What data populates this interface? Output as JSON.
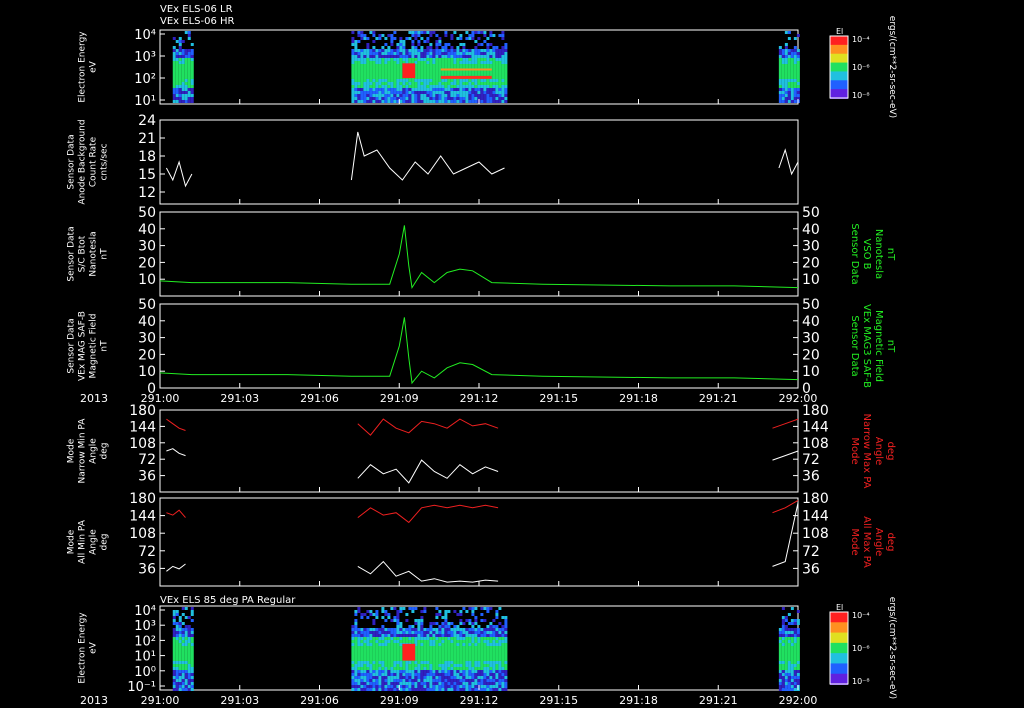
{
  "header": {
    "line1": "VEx ELS-06 LR",
    "line2": "VEx ELS-06 HR"
  },
  "bottom_title": "VEx ELS 85 deg PA Regular",
  "year": "2013",
  "x_ticks": [
    "291:00",
    "291:03",
    "291:06",
    "291:09",
    "291:12",
    "291:15",
    "291:18",
    "291:21",
    "292:00"
  ],
  "colorbar": {
    "title": "El",
    "ticks": [
      "10⁻⁴",
      "10⁻⁶",
      "10⁻⁸"
    ],
    "unit": "ergs/(cm**2-sr-sec-eV)"
  },
  "colors": {
    "bg": "#000000",
    "frame": "#ffffff",
    "green": "#22ee22",
    "red": "#ee2020",
    "white": "#ffffff"
  },
  "chart_data": [
    {
      "type": "heatmap",
      "panel": "spectrogram-top",
      "ylabel": [
        "Electron Energy",
        "eV"
      ],
      "yticks": [
        "10⁴",
        "10³",
        "10²",
        "10¹"
      ],
      "data_intervals": [
        [
          0.02,
          0.05
        ],
        [
          0.3,
          0.54
        ],
        [
          0.97,
          1.0
        ]
      ],
      "hot_spots": [
        [
          0.38,
          0.4,
          "peak"
        ],
        [
          0.44,
          0.52,
          "band"
        ]
      ]
    },
    {
      "type": "line",
      "panel": "background",
      "ylabel": [
        "Sensor Data",
        "Anode Background",
        "Count Rate",
        "cnts/sec"
      ],
      "ylim": [
        10,
        24
      ],
      "yticks": [
        24,
        21,
        18,
        15,
        12
      ],
      "series": [
        {
          "segments": [
            [
              [
                0.01,
                16
              ],
              [
                0.02,
                14
              ],
              [
                0.03,
                17
              ],
              [
                0.04,
                13
              ],
              [
                0.05,
                15
              ]
            ],
            [
              [
                0.3,
                14
              ],
              [
                0.31,
                22
              ],
              [
                0.32,
                18
              ],
              [
                0.34,
                19
              ],
              [
                0.36,
                16
              ],
              [
                0.38,
                14
              ],
              [
                0.4,
                17
              ],
              [
                0.42,
                15
              ],
              [
                0.44,
                18
              ],
              [
                0.46,
                15
              ],
              [
                0.48,
                16
              ],
              [
                0.5,
                17
              ],
              [
                0.52,
                15
              ],
              [
                0.54,
                16
              ]
            ],
            [
              [
                0.97,
                16
              ],
              [
                0.98,
                19
              ],
              [
                0.99,
                15
              ],
              [
                1.0,
                17
              ]
            ]
          ]
        }
      ]
    },
    {
      "type": "line",
      "panel": "mag-vso",
      "ylabel": [
        "Sensor Data",
        "S/C Btot",
        "Nanotesla",
        "nT"
      ],
      "ylabel_right": [
        "Sensor Data",
        "VSO B",
        "Nanotesla",
        "nT"
      ],
      "ylim": [
        0,
        50
      ],
      "yticks": [
        50,
        40,
        30,
        20,
        10
      ],
      "series": [
        {
          "segments": [
            [
              [
                0.0,
                9
              ],
              [
                0.05,
                8
              ],
              [
                0.2,
                8
              ],
              [
                0.3,
                7
              ],
              [
                0.36,
                7
              ],
              [
                0.375,
                25
              ],
              [
                0.383,
                42
              ],
              [
                0.39,
                18
              ],
              [
                0.395,
                5
              ],
              [
                0.41,
                14
              ],
              [
                0.43,
                8
              ],
              [
                0.45,
                14
              ],
              [
                0.47,
                16
              ],
              [
                0.49,
                15
              ],
              [
                0.52,
                8
              ],
              [
                0.6,
                7
              ],
              [
                0.8,
                6
              ],
              [
                0.9,
                6
              ],
              [
                1.0,
                5
              ]
            ]
          ]
        }
      ]
    },
    {
      "type": "line",
      "panel": "mag-saf",
      "ylabel": [
        "Sensor Data",
        "VEx MAG SAF-B",
        "Magnetic Field",
        "nT"
      ],
      "ylabel_right": [
        "Sensor Data",
        "VEx MAG3 SAF-B",
        "Magnetic Field",
        "nT"
      ],
      "ylim": [
        0,
        50
      ],
      "yticks": [
        50,
        40,
        30,
        20,
        10,
        0
      ],
      "series": [
        {
          "segments": [
            [
              [
                0.0,
                9
              ],
              [
                0.05,
                8
              ],
              [
                0.2,
                8
              ],
              [
                0.3,
                7
              ],
              [
                0.36,
                7
              ],
              [
                0.375,
                25
              ],
              [
                0.383,
                42
              ],
              [
                0.39,
                18
              ],
              [
                0.395,
                3
              ],
              [
                0.41,
                10
              ],
              [
                0.43,
                6
              ],
              [
                0.45,
                12
              ],
              [
                0.47,
                15
              ],
              [
                0.49,
                14
              ],
              [
                0.52,
                8
              ],
              [
                0.6,
                7
              ],
              [
                0.8,
                6
              ],
              [
                0.9,
                6
              ],
              [
                1.0,
                5
              ]
            ]
          ]
        }
      ]
    },
    {
      "type": "line",
      "panel": "pa-narrow",
      "ylabel": [
        "Mode",
        "Narrow Min PA",
        "Angle",
        "deg"
      ],
      "ylabel_right": [
        "Mode",
        "Narrow Max PA",
        "Angle",
        "deg"
      ],
      "ylim": [
        0,
        180
      ],
      "yticks": [
        180,
        144,
        108,
        72,
        36
      ],
      "series": [
        {
          "color": "red",
          "segments": [
            [
              [
                0.01,
                160
              ],
              [
                0.02,
                150
              ],
              [
                0.03,
                140
              ],
              [
                0.04,
                135
              ]
            ],
            [
              [
                0.31,
                150
              ],
              [
                0.33,
                125
              ],
              [
                0.35,
                160
              ],
              [
                0.37,
                140
              ],
              [
                0.39,
                130
              ],
              [
                0.41,
                155
              ],
              [
                0.43,
                150
              ],
              [
                0.45,
                140
              ],
              [
                0.47,
                160
              ],
              [
                0.49,
                145
              ],
              [
                0.51,
                150
              ],
              [
                0.53,
                140
              ]
            ],
            [
              [
                0.96,
                140
              ],
              [
                0.98,
                150
              ],
              [
                1.0,
                160
              ]
            ]
          ]
        },
        {
          "color": "white",
          "segments": [
            [
              [
                0.01,
                90
              ],
              [
                0.02,
                95
              ],
              [
                0.03,
                85
              ],
              [
                0.04,
                80
              ]
            ],
            [
              [
                0.31,
                30
              ],
              [
                0.33,
                60
              ],
              [
                0.35,
                40
              ],
              [
                0.37,
                50
              ],
              [
                0.39,
                20
              ],
              [
                0.41,
                70
              ],
              [
                0.43,
                45
              ],
              [
                0.45,
                30
              ],
              [
                0.47,
                60
              ],
              [
                0.49,
                40
              ],
              [
                0.51,
                55
              ],
              [
                0.53,
                45
              ]
            ],
            [
              [
                0.96,
                70
              ],
              [
                0.98,
                80
              ],
              [
                1.0,
                90
              ]
            ]
          ]
        }
      ]
    },
    {
      "type": "line",
      "panel": "pa-all",
      "ylabel": [
        "Mode",
        "All Min PA",
        "Angle",
        "deg"
      ],
      "ylabel_right": [
        "Mode",
        "All Max PA",
        "Angle",
        "deg"
      ],
      "ylim": [
        0,
        180
      ],
      "yticks": [
        180,
        144,
        108,
        72,
        36
      ],
      "series": [
        {
          "color": "red",
          "segments": [
            [
              [
                0.01,
                150
              ],
              [
                0.02,
                145
              ],
              [
                0.03,
                155
              ],
              [
                0.04,
                140
              ]
            ],
            [
              [
                0.31,
                140
              ],
              [
                0.33,
                160
              ],
              [
                0.35,
                145
              ],
              [
                0.37,
                150
              ],
              [
                0.39,
                130
              ],
              [
                0.41,
                160
              ],
              [
                0.43,
                165
              ],
              [
                0.45,
                160
              ],
              [
                0.47,
                165
              ],
              [
                0.49,
                160
              ],
              [
                0.51,
                165
              ],
              [
                0.53,
                160
              ]
            ],
            [
              [
                0.96,
                150
              ],
              [
                0.98,
                160
              ],
              [
                1.0,
                175
              ]
            ]
          ]
        },
        {
          "color": "white",
          "segments": [
            [
              [
                0.01,
                30
              ],
              [
                0.02,
                40
              ],
              [
                0.03,
                35
              ],
              [
                0.04,
                45
              ]
            ],
            [
              [
                0.31,
                40
              ],
              [
                0.33,
                25
              ],
              [
                0.35,
                50
              ],
              [
                0.37,
                20
              ],
              [
                0.39,
                30
              ],
              [
                0.41,
                10
              ],
              [
                0.43,
                15
              ],
              [
                0.45,
                8
              ],
              [
                0.47,
                10
              ],
              [
                0.49,
                8
              ],
              [
                0.51,
                12
              ],
              [
                0.53,
                10
              ]
            ],
            [
              [
                0.96,
                40
              ],
              [
                0.98,
                50
              ],
              [
                1.0,
                170
              ]
            ]
          ]
        }
      ]
    },
    {
      "type": "heatmap",
      "panel": "spectrogram-bottom",
      "ylabel": [
        "Electron Energy",
        "eV"
      ],
      "yticks": [
        "10⁴",
        "10³",
        "10²",
        "10¹",
        "10⁰",
        "10⁻¹"
      ],
      "data_intervals": [
        [
          0.02,
          0.05
        ],
        [
          0.3,
          0.54
        ],
        [
          0.97,
          1.0
        ]
      ],
      "hot_spots": [
        [
          0.38,
          0.4,
          "peak"
        ]
      ]
    }
  ]
}
